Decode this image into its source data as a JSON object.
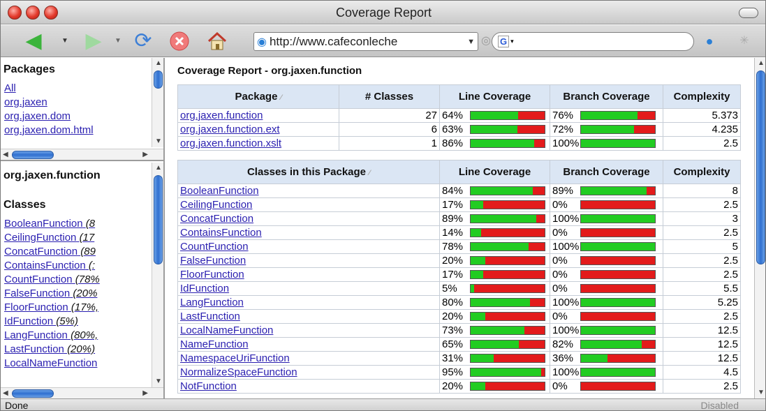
{
  "window": {
    "title": "Coverage Report"
  },
  "toolbar": {
    "url": "http://www.cafeconleche",
    "search_engine_icon": "google-icon",
    "search_placeholder": ""
  },
  "packages_frame": {
    "heading": "Packages",
    "items": [
      {
        "label": "All"
      },
      {
        "label": "org.jaxen"
      },
      {
        "label": "org.jaxen.dom"
      },
      {
        "label": "org.jaxen.dom.html"
      }
    ]
  },
  "classes_frame": {
    "package_name": "org.jaxen.function",
    "heading": "Classes",
    "items": [
      {
        "name": "BooleanFunction",
        "pct": "(8"
      },
      {
        "name": "CeilingFunction",
        "pct": "(17"
      },
      {
        "name": "ConcatFunction",
        "pct": "(89"
      },
      {
        "name": "ContainsFunction",
        "pct": "(:"
      },
      {
        "name": "CountFunction",
        "pct": "(78%"
      },
      {
        "name": "FalseFunction",
        "pct": "(20%"
      },
      {
        "name": "FloorFunction",
        "pct": "(17%,"
      },
      {
        "name": "IdFunction",
        "pct": "(5%)"
      },
      {
        "name": "LangFunction",
        "pct": "(80%,"
      },
      {
        "name": "LastFunction",
        "pct": "(20%)"
      },
      {
        "name": "LocalNameFunction",
        "pct": ""
      }
    ]
  },
  "main": {
    "title": "Coverage Report - org.jaxen.function",
    "package_table": {
      "headers": {
        "package": "Package",
        "classes": "# Classes",
        "line": "Line Coverage",
        "branch": "Branch Coverage",
        "complexity": "Complexity"
      },
      "rows": [
        {
          "name": "org.jaxen.function",
          "classes": "27",
          "line": "64%",
          "line_value": 64,
          "branch": "76%",
          "branch_value": 76,
          "complexity": "5.373"
        },
        {
          "name": "org.jaxen.function.ext",
          "classes": "6",
          "line": "63%",
          "line_value": 63,
          "branch": "72%",
          "branch_value": 72,
          "complexity": "4.235"
        },
        {
          "name": "org.jaxen.function.xslt",
          "classes": "1",
          "line": "86%",
          "line_value": 86,
          "branch": "100%",
          "branch_value": 100,
          "complexity": "2.5"
        }
      ]
    },
    "class_table": {
      "headers": {
        "classes": "Classes in this Package",
        "line": "Line Coverage",
        "branch": "Branch Coverage",
        "complexity": "Complexity"
      },
      "rows": [
        {
          "name": "BooleanFunction",
          "line": "84%",
          "line_value": 84,
          "branch": "89%",
          "branch_value": 89,
          "complexity": "8"
        },
        {
          "name": "CeilingFunction",
          "line": "17%",
          "line_value": 17,
          "branch": "0%",
          "branch_value": 0,
          "complexity": "2.5"
        },
        {
          "name": "ConcatFunction",
          "line": "89%",
          "line_value": 89,
          "branch": "100%",
          "branch_value": 100,
          "complexity": "3"
        },
        {
          "name": "ContainsFunction",
          "line": "14%",
          "line_value": 14,
          "branch": "0%",
          "branch_value": 0,
          "complexity": "2.5"
        },
        {
          "name": "CountFunction",
          "line": "78%",
          "line_value": 78,
          "branch": "100%",
          "branch_value": 100,
          "complexity": "5"
        },
        {
          "name": "FalseFunction",
          "line": "20%",
          "line_value": 20,
          "branch": "0%",
          "branch_value": 0,
          "complexity": "2.5"
        },
        {
          "name": "FloorFunction",
          "line": "17%",
          "line_value": 17,
          "branch": "0%",
          "branch_value": 0,
          "complexity": "2.5"
        },
        {
          "name": "IdFunction",
          "line": "5%",
          "line_value": 5,
          "branch": "0%",
          "branch_value": 0,
          "complexity": "5.5"
        },
        {
          "name": "LangFunction",
          "line": "80%",
          "line_value": 80,
          "branch": "100%",
          "branch_value": 100,
          "complexity": "5.25"
        },
        {
          "name": "LastFunction",
          "line": "20%",
          "line_value": 20,
          "branch": "0%",
          "branch_value": 0,
          "complexity": "2.5"
        },
        {
          "name": "LocalNameFunction",
          "line": "73%",
          "line_value": 73,
          "branch": "100%",
          "branch_value": 100,
          "complexity": "12.5"
        },
        {
          "name": "NameFunction",
          "line": "65%",
          "line_value": 65,
          "branch": "82%",
          "branch_value": 82,
          "complexity": "12.5"
        },
        {
          "name": "NamespaceUriFunction",
          "line": "31%",
          "line_value": 31,
          "branch": "36%",
          "branch_value": 36,
          "complexity": "12.5"
        },
        {
          "name": "NormalizeSpaceFunction",
          "line": "95%",
          "line_value": 95,
          "branch": "100%",
          "branch_value": 100,
          "complexity": "4.5"
        },
        {
          "name": "NotFunction",
          "line": "20%",
          "line_value": 20,
          "branch": "0%",
          "branch_value": 0,
          "complexity": "2.5"
        }
      ]
    }
  },
  "status": {
    "text": "Done",
    "right": "Disabled"
  },
  "colors": {
    "covered": "#22cc22",
    "uncovered": "#e31b1b",
    "header_bg": "#dbe6f4",
    "link": "#2a1fb0"
  }
}
